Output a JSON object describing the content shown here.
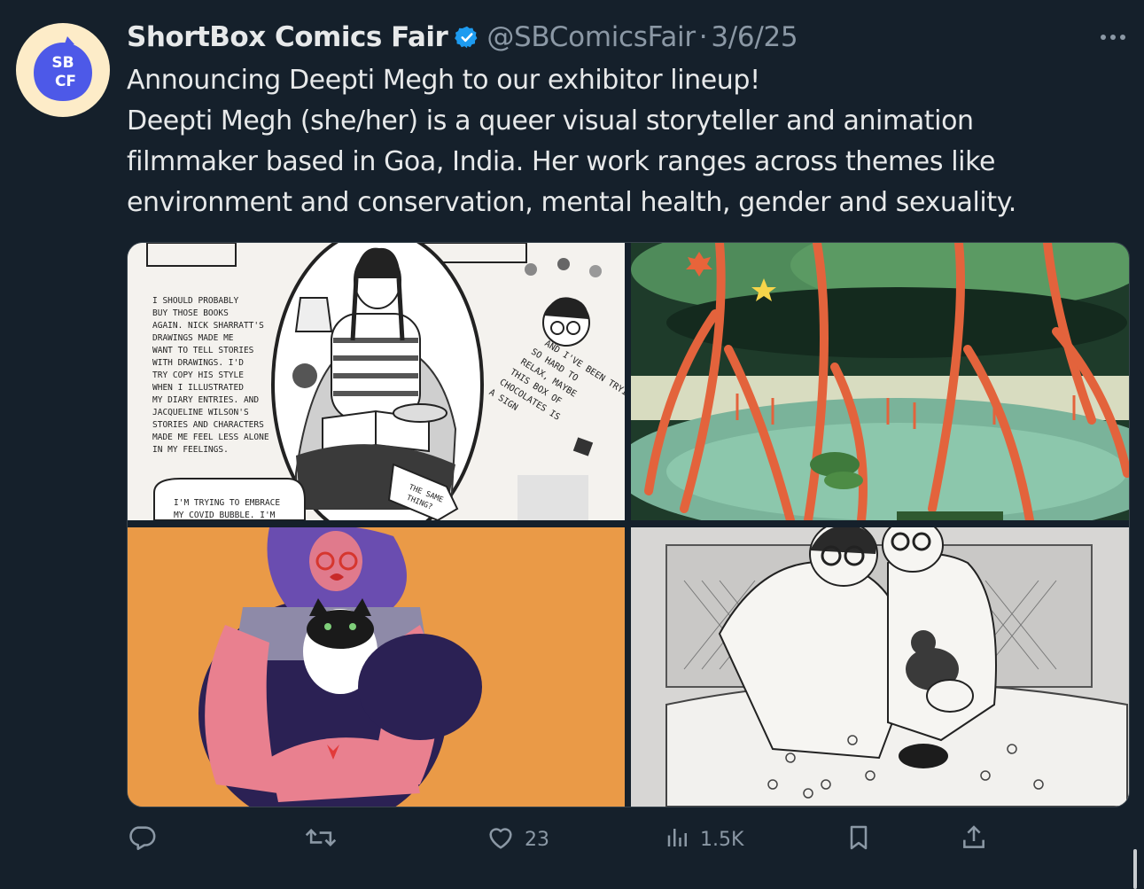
{
  "account": {
    "display_name": "ShortBox Comics Fair",
    "handle": "@SBComicsFair",
    "separator": "·",
    "date": "3/6/25",
    "avatar_text": "SBCF",
    "verified": true
  },
  "tweet": {
    "lines": [
      "Announcing Deepti Megh to our exhibitor lineup!",
      "Deepti Megh (she/her) is a queer visual storyteller and animation",
      "filmmaker based in Goa, India. Her work ranges across themes like",
      "environment and conservation, mental health, gender and sexuality."
    ]
  },
  "media": {
    "comic_panel": {
      "left_caption": [
        "I SHOULD PROBABLY",
        "BUY THOSE BOOKS",
        "AGAIN. NICK SHARRATT'S",
        "DRAWINGS MADE ME",
        "WANT TO TELL STORIES",
        "WITH DRAWINGS. I'D",
        "TRY COPY HIS STYLE",
        "WHEN I ILLUSTRATED",
        "MY DIARY ENTRIES. AND",
        "JACQUELINE WILSON'S",
        "STORIES AND CHARACTERS",
        "MADE ME FEEL LESS ALONE",
        "IN MY FEELINGS."
      ],
      "right_caption": [
        "AND I'VE BEEN TRYING",
        "SO HARD TO",
        "RELAX, MAYBE",
        "THIS BOX OF",
        "CHOCOLATES IS",
        "A SIGN"
      ],
      "bottom_caption": [
        "I'M TRYING TO EMBRACE",
        "MY COVID BUBBLE. I'M"
      ],
      "arrow_caption": [
        "THE SAME",
        "THING?"
      ]
    }
  },
  "actions": {
    "reply_count": "",
    "retweet_count": "",
    "like_count": "23",
    "views_count": "1.5K"
  },
  "colors": {
    "background": "#15202b",
    "text": "#e7e9ea",
    "muted": "#8b98a5",
    "verified": "#1d9bf0",
    "avatar_bg": "#fdecc8",
    "avatar_blob": "#4d59e8"
  }
}
